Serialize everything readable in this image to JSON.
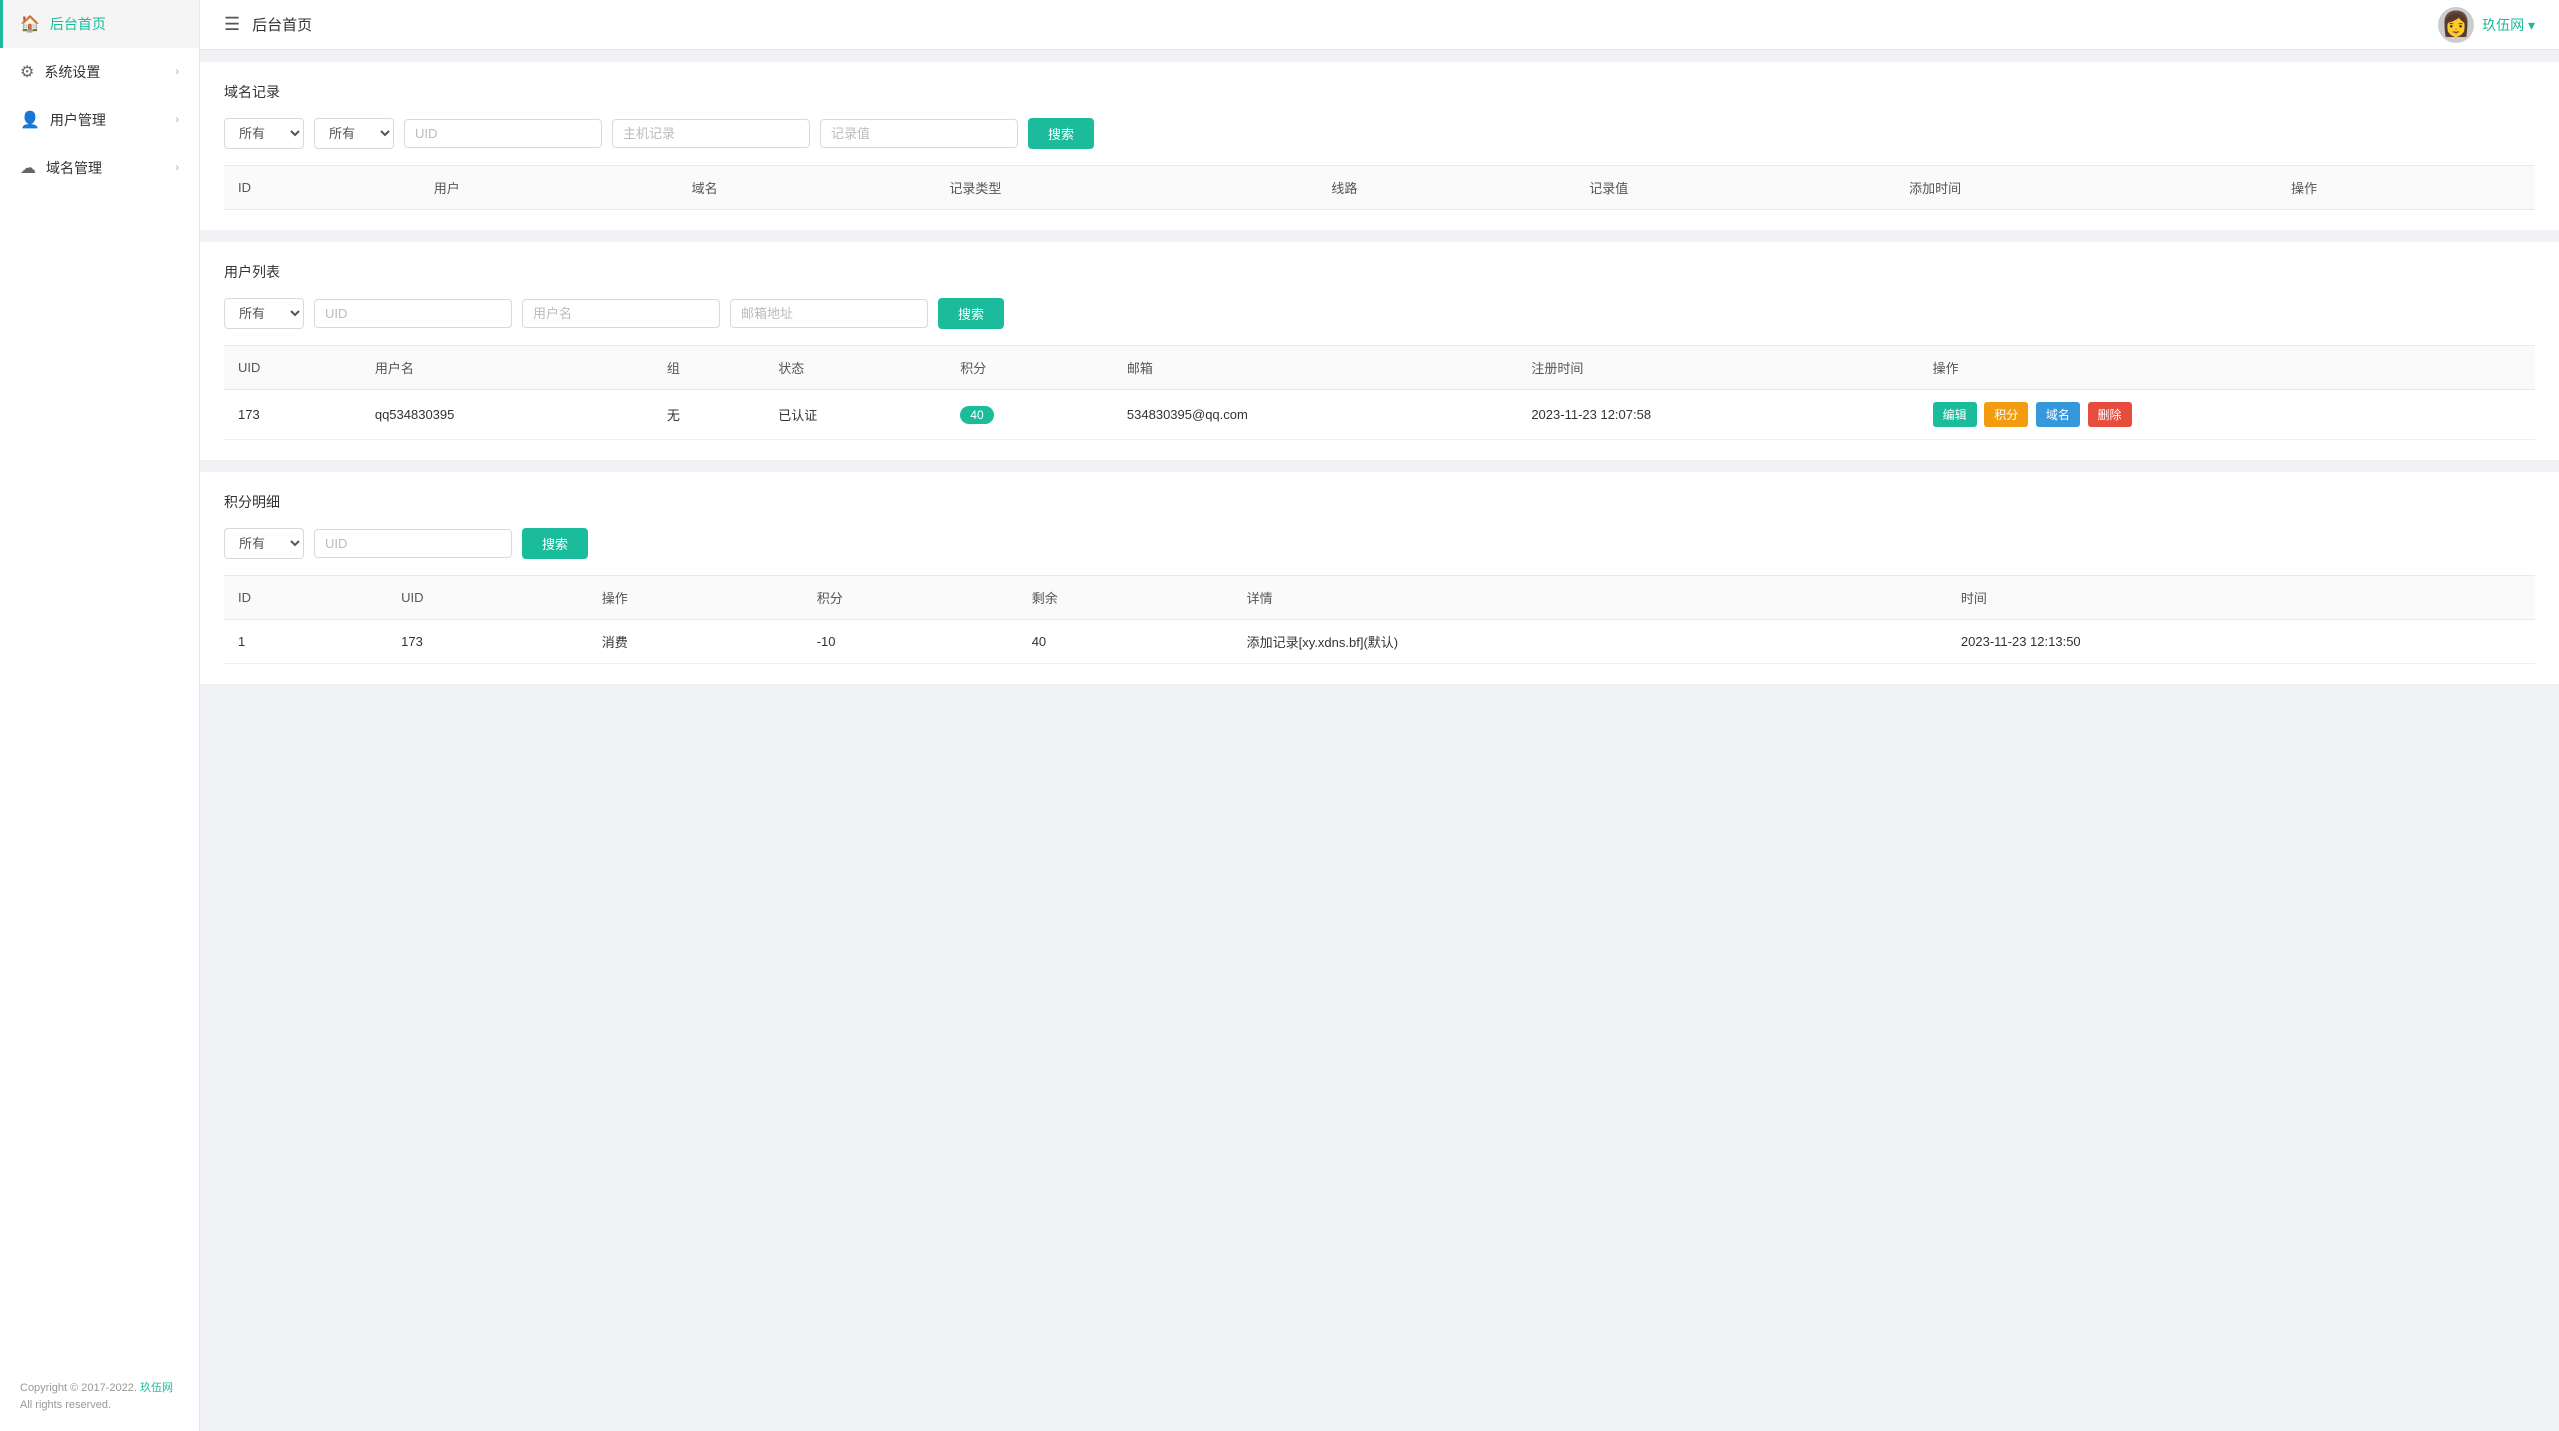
{
  "sidebar": {
    "items": [
      {
        "id": "home",
        "label": "后台首页",
        "icon": "🏠",
        "active": true,
        "hasArrow": false
      },
      {
        "id": "system",
        "label": "系统设置",
        "icon": "⚙",
        "active": false,
        "hasArrow": true
      },
      {
        "id": "user",
        "label": "用户管理",
        "icon": "👤",
        "active": false,
        "hasArrow": true
      },
      {
        "id": "domain",
        "label": "域名管理",
        "icon": "☁",
        "active": false,
        "hasArrow": true
      }
    ],
    "footer": {
      "copyright": "Copyright © 2017-2022.",
      "brand": "玖伍网",
      "rights": "All rights reserved."
    }
  },
  "header": {
    "menu_icon": "☰",
    "title": "后台首页",
    "user_name": "玖伍网 ▾",
    "avatar_emoji": "👩"
  },
  "domain_records": {
    "section_title": "域名记录",
    "filter": {
      "select1_options": [
        "所有"
      ],
      "select1_value": "所有",
      "select2_options": [
        "所有"
      ],
      "select2_value": "所有",
      "input1_placeholder": "UID",
      "input2_placeholder": "主机记录",
      "input3_placeholder": "记录值",
      "search_label": "搜索"
    },
    "columns": [
      "ID",
      "用户",
      "域名",
      "记录类型",
      "线路",
      "记录值",
      "添加时间",
      "操作"
    ],
    "rows": []
  },
  "user_list": {
    "section_title": "用户列表",
    "filter": {
      "select1_options": [
        "所有"
      ],
      "select1_value": "所有",
      "input1_placeholder": "UID",
      "input2_placeholder": "用户名",
      "input3_placeholder": "邮箱地址",
      "search_label": "搜索"
    },
    "columns": [
      "UID",
      "用户名",
      "组",
      "状态",
      "积分",
      "邮箱",
      "注册时间",
      "操作"
    ],
    "rows": [
      {
        "uid": "173",
        "username": "qq534830395",
        "group": "无",
        "status": "已认证",
        "score": "40",
        "email": "534830395@qq.com",
        "reg_time": "2023-11-23 12:07:58",
        "actions": [
          "编辑",
          "积分",
          "域名",
          "删除"
        ]
      }
    ]
  },
  "score_detail": {
    "section_title": "积分明细",
    "filter": {
      "select1_options": [
        "所有"
      ],
      "select1_value": "所有",
      "input1_placeholder": "UID",
      "search_label": "搜索"
    },
    "columns": [
      "ID",
      "UID",
      "操作",
      "积分",
      "剩余",
      "详情",
      "时间"
    ],
    "rows": [
      {
        "id": "1",
        "uid": "173",
        "action": "消费",
        "score": "-10",
        "remaining": "40",
        "detail": "添加记录[xy.xdns.bf](默认)",
        "time": "2023-11-23 12:13:50"
      }
    ]
  }
}
